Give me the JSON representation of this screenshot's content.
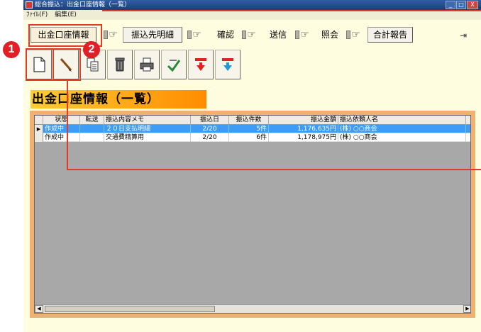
{
  "window": {
    "title": "総合振込：出金口座情報（一覧）",
    "controls": [
      "minimize-icon",
      "maximize-icon",
      "close-icon"
    ]
  },
  "menu": {
    "items": [
      "ﾌｧｲﾙ(F)",
      "編集(E)"
    ]
  },
  "nav": {
    "steps": [
      "出金口座情報",
      "振込先明細",
      "確認",
      "送信",
      "照会",
      "合計報告"
    ],
    "active": "出金口座情報",
    "exit_icon": "exit-door-icon"
  },
  "toolbar": {
    "icons": [
      "new-document-icon",
      "edit-pencil-icon",
      "copy-icon",
      "delete-trash-icon",
      "print-icon",
      "confirm-check-icon",
      "upload-red-icon",
      "download-red-icon"
    ]
  },
  "heading": "出金口座情報（一覧）",
  "grid": {
    "columns": [
      "状態",
      "転送",
      "振込内容メモ",
      "振込日",
      "振込件数",
      "振込金額",
      "振込依頼人名"
    ],
    "rows": [
      {
        "status": "作成中",
        "transfer": "",
        "memo": "２０日支払明細",
        "date": "2/20",
        "count": "5件",
        "amount": "1,176,635円",
        "client": "(株) ○○商会",
        "selected": true
      },
      {
        "status": "作成中",
        "transfer": "",
        "memo": "交通費精算用",
        "date": "2/20",
        "count": "6件",
        "amount": "1,178,975円",
        "client": "(株) ○○商会",
        "selected": false
      }
    ]
  },
  "callouts": [
    "1",
    "2"
  ],
  "colors": {
    "highlight": "#e03a2a",
    "selection": "#3e9cf5",
    "heading": "#ff8c00",
    "panel": "#fffde0"
  }
}
